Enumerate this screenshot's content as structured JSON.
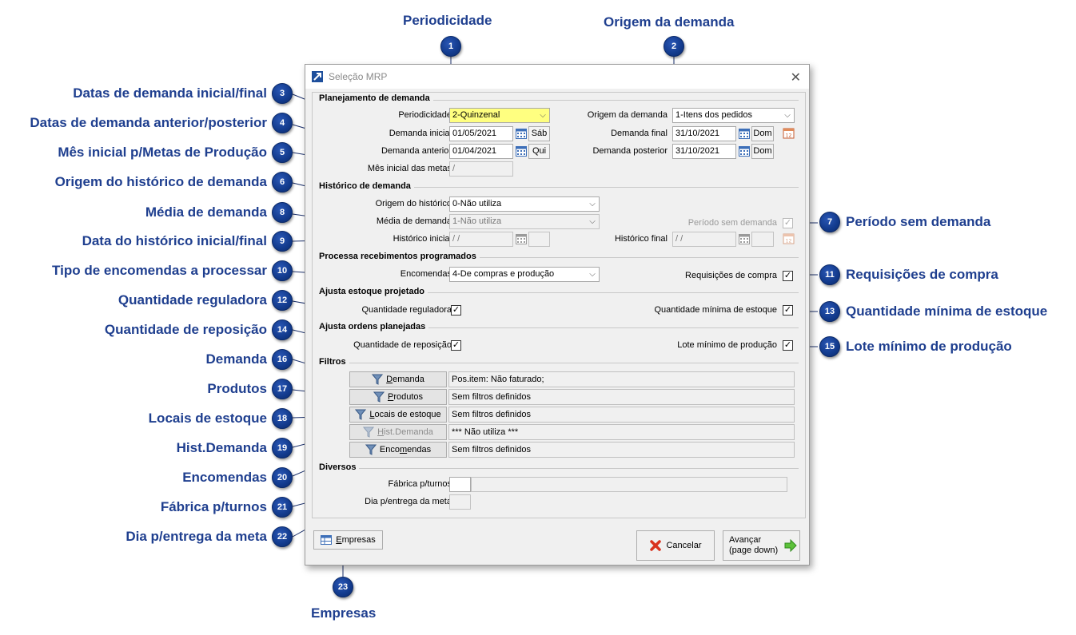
{
  "annotations": {
    "a1": {
      "num": "1",
      "label": "Periodicidade"
    },
    "a2": {
      "num": "2",
      "label": "Origem da demanda"
    },
    "a3": {
      "num": "3",
      "label": "Datas de demanda inicial/final"
    },
    "a4": {
      "num": "4",
      "label": "Datas de demanda anterior/posterior"
    },
    "a5": {
      "num": "5",
      "label": "Mês inicial p/Metas de Produção"
    },
    "a6": {
      "num": "6",
      "label": "Origem do histórico de demanda"
    },
    "a7": {
      "num": "7",
      "label": "Período sem demanda"
    },
    "a8": {
      "num": "8",
      "label": "Média de demanda"
    },
    "a9": {
      "num": "9",
      "label": "Data do histórico inicial/final"
    },
    "a10": {
      "num": "10",
      "label": "Tipo de encomendas a processar"
    },
    "a11": {
      "num": "11",
      "label": "Requisições de compra"
    },
    "a12": {
      "num": "12",
      "label": "Quantidade reguladora"
    },
    "a13": {
      "num": "13",
      "label": "Quantidade mínima de estoque"
    },
    "a14": {
      "num": "14",
      "label": "Quantidade de reposição"
    },
    "a15": {
      "num": "15",
      "label": "Lote mínimo de produção"
    },
    "a16": {
      "num": "16",
      "label": "Demanda"
    },
    "a17": {
      "num": "17",
      "label": "Produtos"
    },
    "a18": {
      "num": "18",
      "label": "Locais de estoque"
    },
    "a19": {
      "num": "19",
      "label": "Hist.Demanda"
    },
    "a20": {
      "num": "20",
      "label": "Encomendas"
    },
    "a21": {
      "num": "21",
      "label": "Fábrica p/turnos"
    },
    "a22": {
      "num": "22",
      "label": "Dia p/entrega da meta"
    },
    "a23": {
      "num": "23",
      "label": "Empresas"
    }
  },
  "dialog": {
    "title": "Seleção MRP",
    "close": "✕",
    "sections": {
      "planejamento": "Planejamento de demanda",
      "historico": "Histórico de demanda",
      "recebimentos": "Processa recebimentos programados",
      "estoque": "Ajusta estoque projetado",
      "ordens": "Ajusta ordens planejadas",
      "filtros": "Filtros",
      "diversos": "Diversos"
    },
    "fields": {
      "periodicidade": {
        "label": "Periodicidade",
        "value": "2-Quinzenal"
      },
      "origem_demanda": {
        "label": "Origem da demanda",
        "value": "1-Itens dos pedidos"
      },
      "demanda_inicial": {
        "label": "Demanda inicial",
        "value": "01/05/2021",
        "day": "Sáb"
      },
      "demanda_final": {
        "label": "Demanda final",
        "value": "31/10/2021",
        "day": "Dom"
      },
      "demanda_anterior": {
        "label": "Demanda anterior",
        "value": "01/04/2021",
        "day": "Qui"
      },
      "demanda_posterior": {
        "label": "Demanda posterior",
        "value": "31/10/2021",
        "day": "Dom"
      },
      "mes_inicial": {
        "label": "Mês inicial das metas",
        "value": "  /"
      },
      "origem_historico": {
        "label": "Origem do histórico",
        "value": "0-Não utiliza"
      },
      "media_demanda": {
        "label": "Média de demanda",
        "value": "1-Não utiliza"
      },
      "periodo_sem_demanda": {
        "label": "Período sem demanda",
        "checked": "✓"
      },
      "historico_inicial": {
        "label": "Histórico inicial",
        "value": "  /  /"
      },
      "historico_final": {
        "label": "Histórico final",
        "value": "  /  /"
      },
      "encomendas": {
        "label": "Encomendas",
        "value": "4-De compras e produção"
      },
      "requisicoes_compra": {
        "label": "Requisições de compra",
        "checked": "✓"
      },
      "quantidade_reguladora": {
        "label": "Quantidade reguladora",
        "checked": "✓"
      },
      "quantidade_minima": {
        "label": "Quantidade mínima de estoque",
        "checked": "✓"
      },
      "quantidade_reposicao": {
        "label": "Quantidade de reposição",
        "checked": "✓"
      },
      "lote_minimo": {
        "label": "Lote mínimo de produção",
        "checked": "✓"
      },
      "fabrica_turnos": {
        "label": "Fábrica p/turnos",
        "value": ""
      },
      "dia_entrega": {
        "label": "Dia p/entrega da meta",
        "value": ""
      }
    },
    "filters": [
      {
        "pre": "",
        "u": "D",
        "post": "emanda",
        "text": "Pos.item: Não faturado;"
      },
      {
        "pre": "",
        "u": "P",
        "post": "rodutos",
        "text": "Sem filtros definidos"
      },
      {
        "pre": "",
        "u": "L",
        "post": "ocais de estoque",
        "text": "Sem filtros definidos"
      },
      {
        "pre": "",
        "u": "H",
        "post": "ist.Demanda",
        "text": "*** Não utiliza ***"
      },
      {
        "pre": "Enco",
        "u": "m",
        "post": "endas",
        "text": "Sem filtros definidos"
      }
    ],
    "buttons": {
      "empresas_u": "E",
      "empresas_rest": "mpresas",
      "cancelar": "Cancelar",
      "avancar_line1": "Avançar",
      "avancar_line2": "(page down)"
    }
  },
  "colors": {
    "accent": "#123a8c",
    "annotation_text": "#1f3f8f",
    "highlight_field": "#ffff80"
  }
}
